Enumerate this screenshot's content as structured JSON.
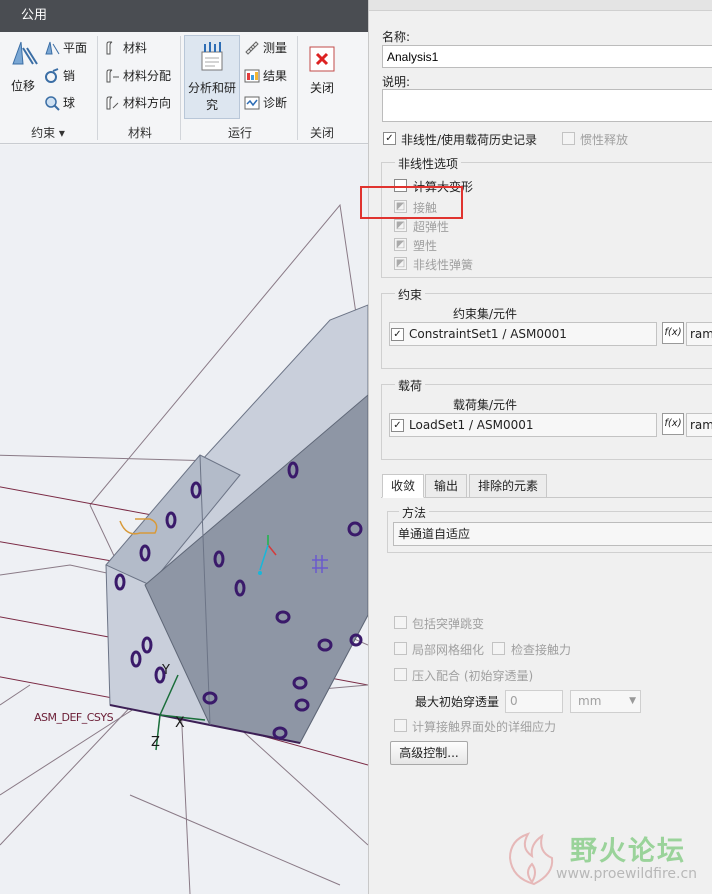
{
  "ribbon": {
    "tab_label": "公用",
    "groups": {
      "constraints": {
        "label": "约束",
        "big_button": "位移",
        "items": [
          "平面",
          "销",
          "球"
        ]
      },
      "materials": {
        "label": "材料",
        "items": [
          "材料",
          "材料分配",
          "材料方向"
        ]
      },
      "run": {
        "label": "运行",
        "big_button_line1": "分析和研",
        "big_button_line2": "究",
        "items": [
          "测量",
          "结果",
          "诊断"
        ]
      },
      "close": {
        "label": "关闭",
        "big_button": "关闭"
      }
    }
  },
  "viewport": {
    "csys_label": "ASM_DEF_CSYS",
    "axis_labels": {
      "x": "X",
      "y": "Y",
      "z": "Z"
    }
  },
  "dialog": {
    "name_label": "名称:",
    "name_value": "Analysis1",
    "description_label": "说明:",
    "description_value": "",
    "nonlinear_check": {
      "label": "非线性/使用载荷历史记录",
      "checked": true
    },
    "inertia_relief": {
      "label": "惯性释放",
      "checked": false,
      "disabled": true
    },
    "nonlinear_options": {
      "title": "非线性选项",
      "items": [
        {
          "label": "计算大变形",
          "checked": false,
          "disabled": false
        },
        {
          "label": "接触",
          "checked": true,
          "disabled": true
        },
        {
          "label": "超弹性",
          "checked": true,
          "disabled": true
        },
        {
          "label": "塑性",
          "checked": true,
          "disabled": true
        },
        {
          "label": "非线性弹簧",
          "checked": true,
          "disabled": true
        }
      ]
    },
    "constraints": {
      "title": "约束",
      "column_header": "约束集/元件",
      "row": {
        "checked": true,
        "value": "ConstraintSet1 / ASM0001",
        "fx": "f(x)",
        "extra": "ram"
      }
    },
    "loads": {
      "title": "载荷",
      "column_header": "载荷集/元件",
      "row": {
        "checked": true,
        "value": "LoadSet1 / ASM0001",
        "fx": "f(x)",
        "extra": "ram"
      }
    },
    "tabs": [
      "收敛",
      "输出",
      "排除的元素"
    ],
    "method": {
      "title": "方法",
      "value": "单通道自适应"
    },
    "convergence_options": {
      "include_snap": "包括突弹跳变",
      "local_mesh": "局部网格细化",
      "check_contact": "检查接触力",
      "press_fit": "压入配合 (初始穿透量)",
      "max_penetration_label": "最大初始穿透量",
      "max_penetration_value": "0",
      "unit": "mm",
      "detailed_stress": "计算接触界面处的详细应力"
    },
    "advanced_button": "高级控制..."
  },
  "watermark": {
    "text": "野火论坛",
    "url": "www.proewildfire.cn"
  }
}
